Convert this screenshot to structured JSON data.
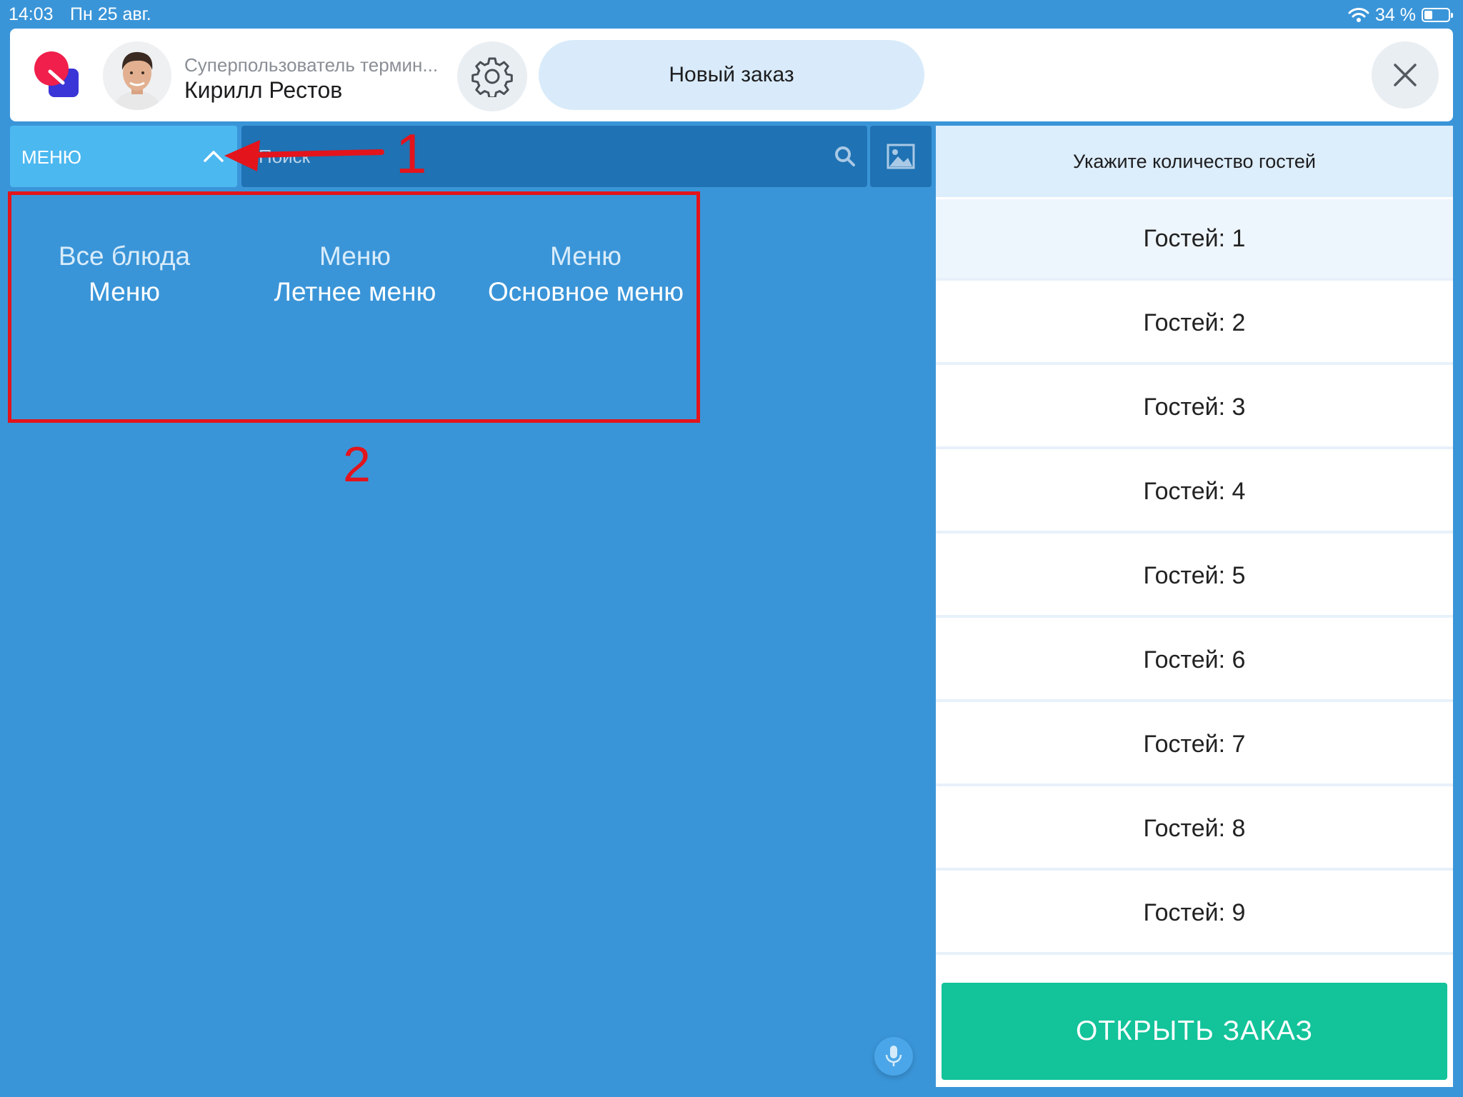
{
  "status_bar": {
    "time": "14:03",
    "date": "Пн 25 авг.",
    "battery": "34 %"
  },
  "header": {
    "user_role": "Суперпользователь термин...",
    "user_name": "Кирилл Рестов",
    "new_order_label": "Новый заказ"
  },
  "toolbar": {
    "menu_label": "МЕНЮ",
    "search_placeholder": "Поиск"
  },
  "menu_tiles": [
    {
      "line1": "Все блюда",
      "line2": "Меню",
      "active": true
    },
    {
      "line1": "Меню",
      "line2": "Летнее меню",
      "active": false
    },
    {
      "line1": "Меню",
      "line2": "Основное меню",
      "active": false
    }
  ],
  "annotations": {
    "marker1": "1",
    "marker2": "2"
  },
  "guests": {
    "title": "Укажите количество гостей",
    "options": [
      "Гостей: 1",
      "Гостей: 2",
      "Гостей: 3",
      "Гостей: 4",
      "Гостей: 5",
      "Гостей: 6",
      "Гостей: 7",
      "Гостей: 8",
      "Гостей: 9"
    ],
    "selected_index": 0
  },
  "open_order_label": "ОТКРЫТЬ ЗАКАЗ",
  "colors": {
    "background": "#3a95d8",
    "accent_green": "#13c39a",
    "annotation_red": "#e3141c"
  },
  "icons": [
    "wifi-icon",
    "battery-icon",
    "app-logo",
    "avatar",
    "gear-icon",
    "close-icon",
    "chevron-up-icon",
    "search-icon",
    "image-icon",
    "microphone-icon"
  ]
}
